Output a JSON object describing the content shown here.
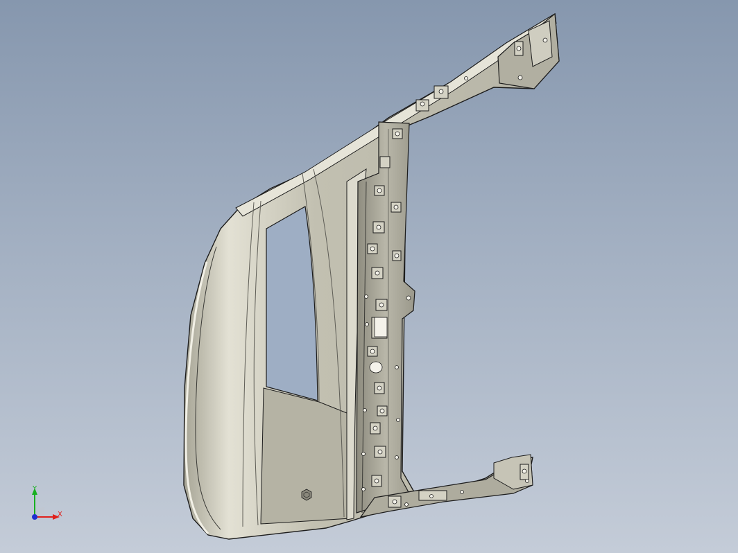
{
  "viewport": {
    "background_top": "#8697ae",
    "background_bottom": "#c4ccd8"
  },
  "part": {
    "surface_color": "#c9c6b6",
    "shadow_color": "#8c8a7c",
    "edge_color": "#1c1c1c",
    "rib_color": "#6f6e66"
  },
  "triad": {
    "x_label": "X",
    "y_label": "Y",
    "x_color": "#e0201c",
    "y_color": "#18b020",
    "z_color": "#2030d0"
  }
}
